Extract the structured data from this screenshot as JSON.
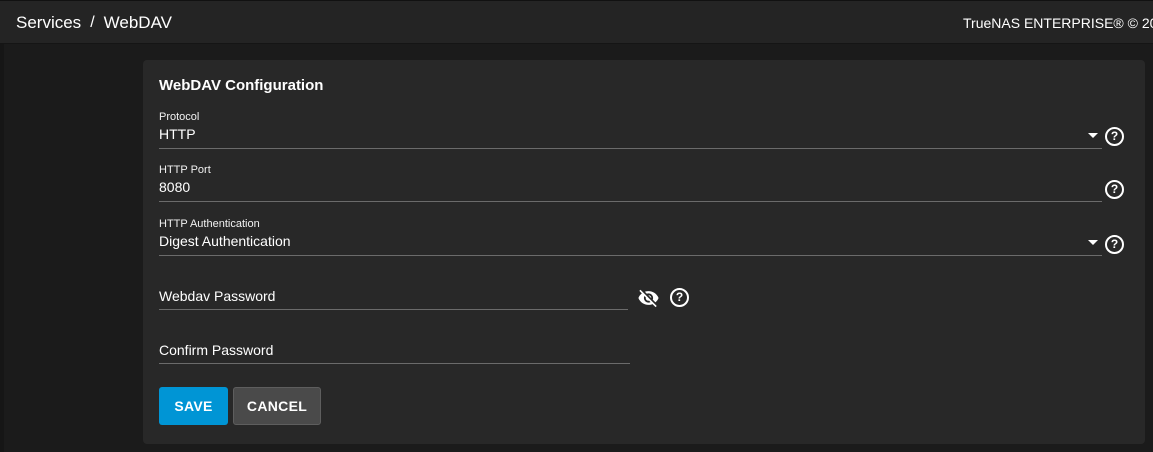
{
  "breadcrumb": {
    "section": "Services",
    "separator": "/",
    "page": "WebDAV"
  },
  "header": {
    "copyright": "TrueNAS ENTERPRISE® © 20"
  },
  "card": {
    "title": "WebDAV Configuration",
    "protocol": {
      "label": "Protocol",
      "value": "HTTP"
    },
    "http_port": {
      "label": "HTTP Port",
      "value": "8080"
    },
    "http_auth": {
      "label": "HTTP Authentication",
      "value": "Digest Authentication"
    },
    "password": {
      "placeholder": "Webdav Password"
    },
    "confirm_password": {
      "placeholder": "Confirm Password"
    },
    "help_glyph": "?",
    "buttons": {
      "save": "SAVE",
      "cancel": "CANCEL"
    }
  },
  "colors": {
    "accent": "#0095d5",
    "background": "#1b1b1b",
    "card": "#282828"
  }
}
